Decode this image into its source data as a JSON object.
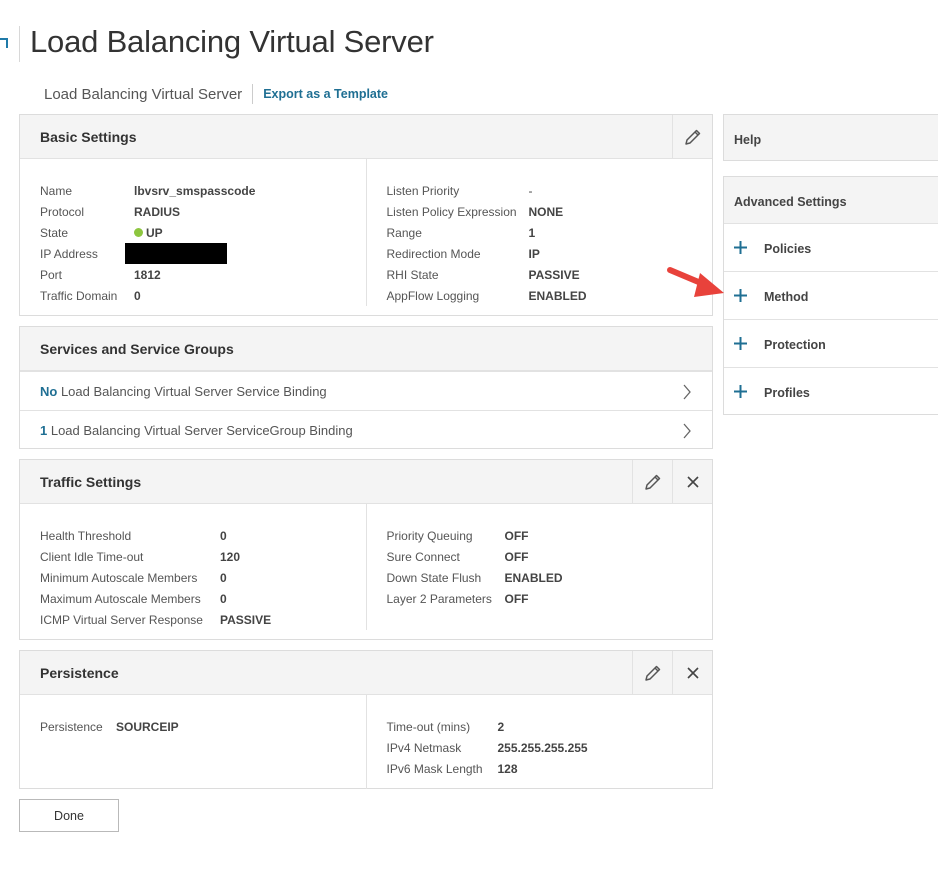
{
  "page": {
    "title": "Load Balancing Virtual Server",
    "breadcrumb": "Load Balancing Virtual Server",
    "export_link": "Export as a Template"
  },
  "basic_settings": {
    "title": "Basic Settings",
    "left": [
      {
        "key": "Name",
        "value": "lbvsrv_smspasscode"
      },
      {
        "key": "Protocol",
        "value": "RADIUS"
      },
      {
        "key": "State",
        "value": "UP"
      },
      {
        "key": "IP Address",
        "value": ""
      },
      {
        "key": "Port",
        "value": "1812"
      },
      {
        "key": "Traffic Domain",
        "value": "0"
      }
    ],
    "right": [
      {
        "key": "Listen Priority",
        "value": "-"
      },
      {
        "key": "Listen Policy Expression",
        "value": "NONE"
      },
      {
        "key": "Range",
        "value": "1"
      },
      {
        "key": "Redirection Mode",
        "value": "IP"
      },
      {
        "key": "RHI State",
        "value": "PASSIVE"
      },
      {
        "key": "AppFlow Logging",
        "value": "ENABLED"
      }
    ]
  },
  "services": {
    "title": "Services and Service Groups",
    "rows": [
      {
        "count": "No",
        "label": " Load Balancing Virtual Server Service Binding"
      },
      {
        "count": "1",
        "label": " Load Balancing Virtual Server ServiceGroup Binding"
      }
    ]
  },
  "traffic_settings": {
    "title": "Traffic Settings",
    "left": [
      {
        "key": "Health Threshold",
        "value": "0"
      },
      {
        "key": "Client Idle Time-out",
        "value": "120"
      },
      {
        "key": "Minimum Autoscale Members",
        "value": "0"
      },
      {
        "key": "Maximum Autoscale Members",
        "value": "0"
      },
      {
        "key": "ICMP Virtual Server Response",
        "value": "PASSIVE"
      }
    ],
    "right": [
      {
        "key": "Priority Queuing",
        "value": "OFF"
      },
      {
        "key": "Sure Connect",
        "value": "OFF"
      },
      {
        "key": "Down State Flush",
        "value": "ENABLED"
      },
      {
        "key": "Layer 2 Parameters",
        "value": "OFF"
      }
    ]
  },
  "persistence": {
    "title": "Persistence",
    "left": [
      {
        "key": "Persistence",
        "value": "SOURCEIP"
      }
    ],
    "right": [
      {
        "key": "Time-out (mins)",
        "value": "2"
      },
      {
        "key": "IPv4 Netmask",
        "value": "255.255.255.255"
      },
      {
        "key": "IPv6 Mask Length",
        "value": "128"
      }
    ]
  },
  "sidebar": {
    "help": "Help",
    "advanced_title": "Advanced Settings",
    "items": [
      {
        "label": "Policies"
      },
      {
        "label": "Method"
      },
      {
        "label": "Protection"
      },
      {
        "label": "Profiles"
      }
    ]
  },
  "done_label": "Done",
  "colors": {
    "accent": "#1f6f93",
    "state_up": "#8dc63f",
    "annotation_arrow": "#e8423b",
    "panel_header": "#f4f4f4"
  },
  "icons": {
    "edit": "pencil-icon",
    "close": "close-icon",
    "chevron": "chevron-right-icon",
    "add": "plus-icon",
    "state": "status-dot-icon"
  }
}
